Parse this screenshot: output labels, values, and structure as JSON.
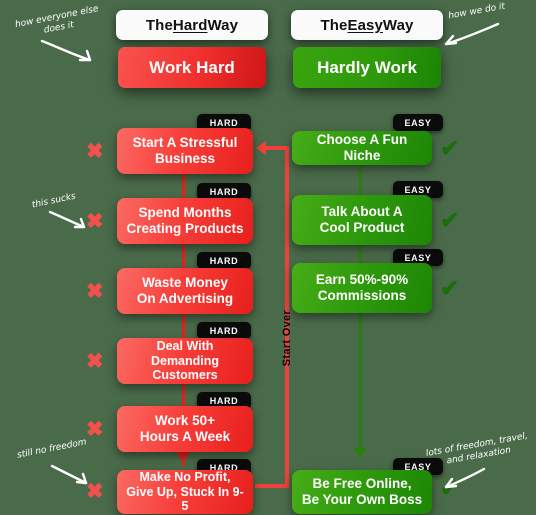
{
  "theme": {
    "background": "#4a6b4a",
    "red": "#f0302e",
    "red_dark": "#cf1616",
    "green": "#2e9a0b",
    "green_dark": "#1c8405",
    "badge_bg": "#0b0b0b",
    "card_bg": "#fbfbfb",
    "x_color": "#f4514c",
    "check_color": "#1c6d0b"
  },
  "columns": {
    "hard": {
      "header": {
        "prefix": "The ",
        "emphasis": "Hard",
        "suffix": " Way"
      },
      "hero": "Work Hard",
      "badge": "HARD",
      "mark": "✖",
      "steps": [
        {
          "label": "Start A Stressful\nBusiness",
          "badge": "HARD",
          "mark": "✖"
        },
        {
          "label": "Spend Months\nCreating Products",
          "badge": "HARD",
          "mark": "✖"
        },
        {
          "label": "Waste Money\nOn Advertising",
          "badge": "HARD",
          "mark": "✖"
        },
        {
          "label": "Deal With Demanding\nCustomers",
          "badge": "HARD",
          "mark": "✖"
        },
        {
          "label": "Work 50+\nHours A Week",
          "badge": "HARD",
          "mark": "✖"
        },
        {
          "label": "Make No Profit,\nGive Up, Stuck In 9-5",
          "badge": "HARD",
          "mark": "✖"
        }
      ]
    },
    "easy": {
      "header": {
        "prefix": "The ",
        "emphasis": "Easy",
        "suffix": " Way"
      },
      "hero": "Hardly Work",
      "badge": "EASY",
      "mark": "✔",
      "steps": [
        {
          "label": "Choose A Fun Niche",
          "badge": "EASY",
          "mark": "✔"
        },
        {
          "label": "Talk About A\nCool Product",
          "badge": "EASY",
          "mark": "✔"
        },
        {
          "label": "Earn 50%-90%\nCommissions",
          "badge": "EASY",
          "mark": "✔"
        },
        {
          "label": "Be Free Online,\nBe Your Own Boss",
          "badge": "EASY",
          "mark": "✔"
        }
      ]
    }
  },
  "loop": {
    "label": "Start Over"
  },
  "annotations": {
    "top_left": "how everyone else\ndoes it",
    "top_right": "how we do it",
    "mid_left": "this sucks",
    "bottom_left": "still no freedom",
    "bottom_right": "lots of freedom, travel,\nand relaxation"
  }
}
